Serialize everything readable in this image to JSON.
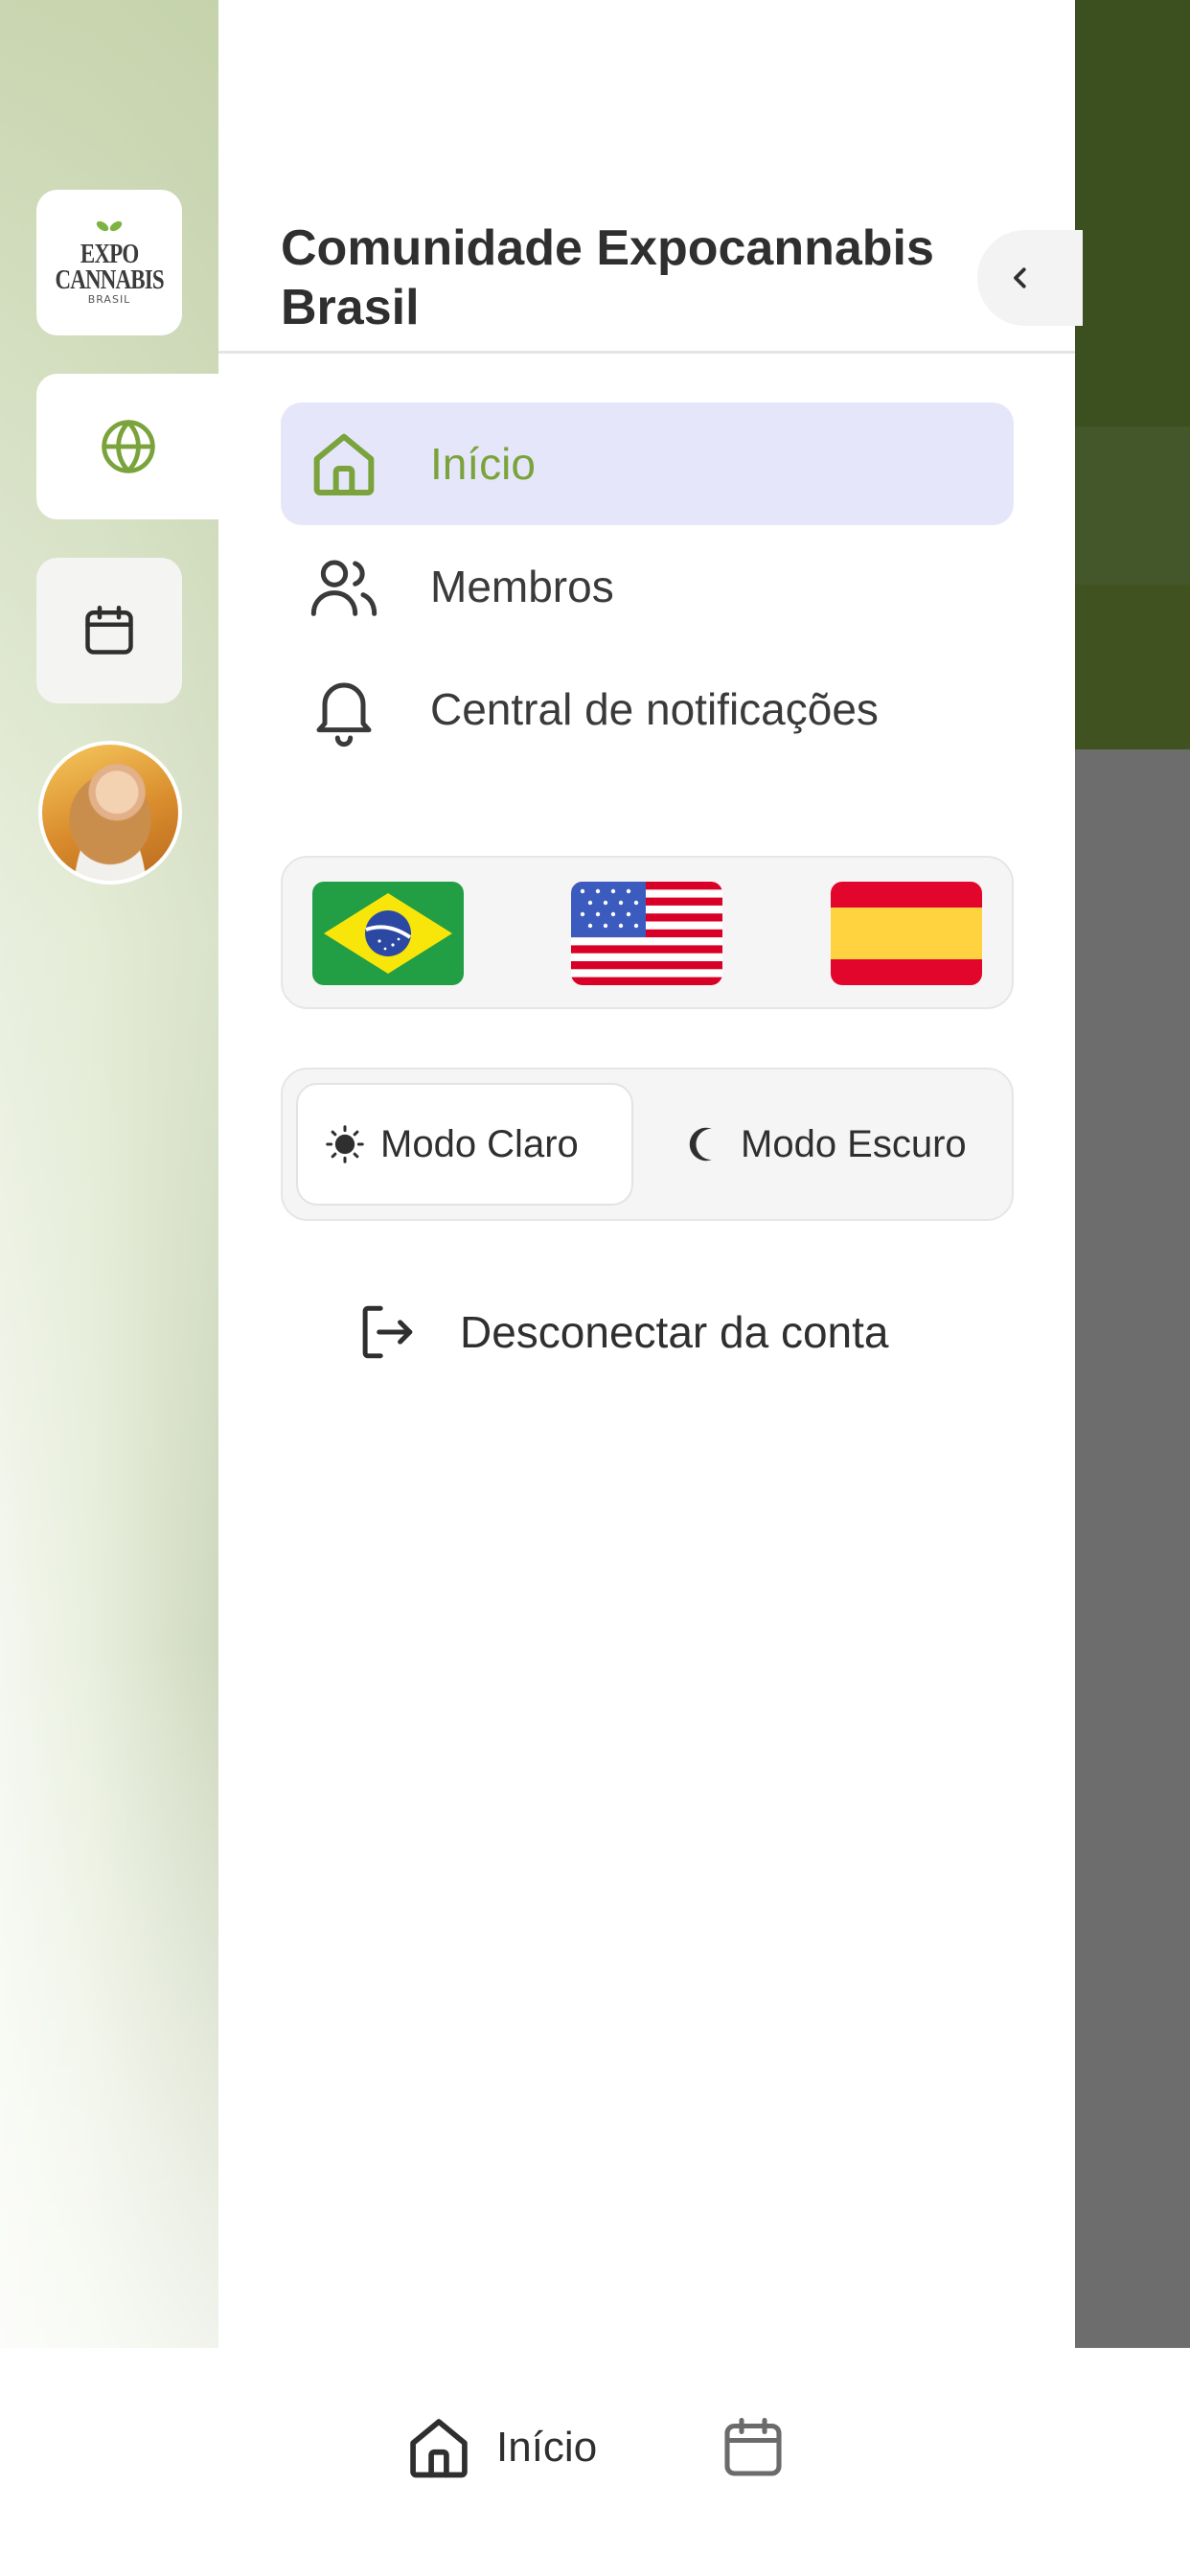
{
  "rail": {
    "logo_line1": "EXPO",
    "logo_line2": "CANNABIS",
    "logo_line3": "BRASIL",
    "items": [
      {
        "icon": "globe-icon"
      },
      {
        "icon": "calendar-icon"
      },
      {
        "icon": "avatar"
      }
    ]
  },
  "drawer": {
    "title": "Comunidade Expocannabis Brasil",
    "nav": [
      {
        "label": "Início",
        "icon": "home-icon",
        "active": true
      },
      {
        "label": "Membros",
        "icon": "users-icon",
        "active": false
      },
      {
        "label": "Central de notificações",
        "icon": "bell-icon",
        "active": false
      }
    ],
    "languages": [
      {
        "flag": "brazil-flag"
      },
      {
        "flag": "usa-flag"
      },
      {
        "flag": "spain-flag"
      }
    ],
    "theme": {
      "light_label": "Modo Claro",
      "dark_label": "Modo Escuro",
      "selected": "light"
    },
    "logout_label": "Desconectar da conta"
  },
  "bottom_bar": {
    "home_label": "Início"
  },
  "colors": {
    "accent": "#7aa33c",
    "active_bg": "#e6e6fa",
    "overlay": "#6d6d6d",
    "header_green": "#3b4f1f"
  }
}
